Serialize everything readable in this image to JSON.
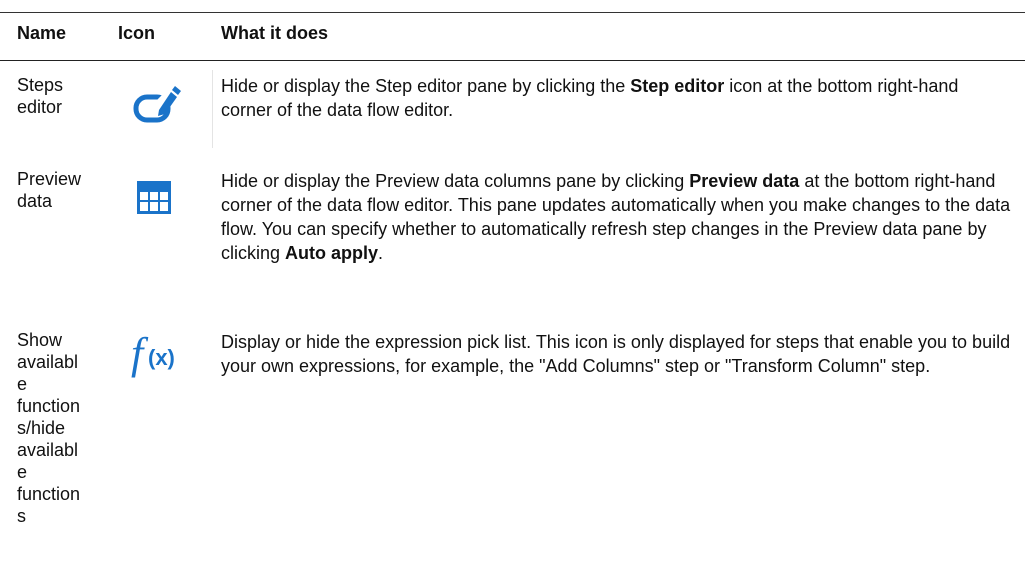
{
  "table": {
    "headers": {
      "name": "Name",
      "icon": "Icon",
      "desc": "What it does"
    },
    "rows": [
      {
        "name_lines": [
          "Steps",
          "editor"
        ],
        "icon": "step-editor-icon",
        "desc_parts": [
          "Hide or display the Step editor pane by clicking the ",
          "Step editor",
          " icon at the bottom right-hand corner of the data flow editor."
        ]
      },
      {
        "name_lines": [
          "Preview",
          "data"
        ],
        "icon": "preview-data-grid-icon",
        "desc_parts": [
          "Hide or display the Preview data columns pane by clicking ",
          "Preview data",
          " at the bottom right-hand corner of the data flow editor. This pane updates automatically when you make changes to the data flow. You can specify whether to automatically refresh step changes in the Preview data pane by clicking ",
          "Auto apply",
          "."
        ]
      },
      {
        "name_lines": [
          "Show",
          "availabl",
          "e",
          "function",
          "s/hide",
          "availabl",
          "e",
          "function",
          "s"
        ],
        "icon": "function-fx-icon",
        "desc_parts": [
          "Display or hide the expression pick list. This icon is only displayed for steps that enable you to build your own expressions, for example, the \"Add Columns\" step or \"Transform Column\" step."
        ]
      }
    ]
  },
  "colors": {
    "icon_blue": "#1a73c9",
    "rule": "#222222"
  }
}
